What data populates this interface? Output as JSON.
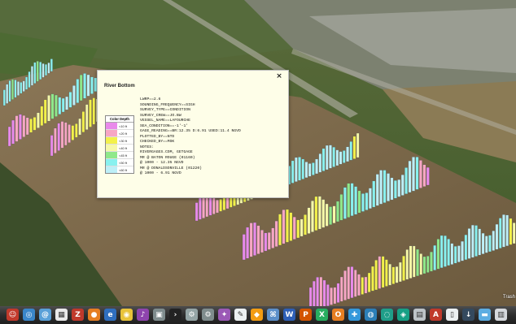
{
  "popup": {
    "title": "River Bottom",
    "close_glyph": "×",
    "legend": {
      "title": "Color Depth",
      "items": [
        {
          "label": "<10 ft",
          "color": "#e98aeb"
        },
        {
          "label": "<20 ft",
          "color": "#f7a6c4"
        },
        {
          "label": "<30 ft",
          "color": "#f3f14a"
        },
        {
          "label": "<40 ft",
          "color": "#f6f8a8"
        },
        {
          "label": "<45 ft",
          "color": "#8fe88a"
        },
        {
          "label": "<50 ft",
          "color": "#89f1ef"
        },
        {
          "label": "<60 ft",
          "color": "#bdeff7"
        }
      ]
    },
    "attributes": [
      "LWRP==2.6",
      "SOUNDING_FREQUENCY==SIGH",
      "SURVEY_TYPE==CONDITION",
      "SURVEY_CREW==JO.BW",
      "VESSEL_NAME==LAFOURCHE",
      "SEA_CONDITION==-1'-1'",
      "GAGE_READING==BR:12.35 D:6.91 USED:11.4 NGVD",
      "PLOTTED_BY==NTD",
      "CHECKED_BY==MSK",
      "NOTES:",
      "RIVERGAGES.COM, GETGAGE",
      "MR @ BATON ROUGE (01160)",
      "@ 1000 - 12.35 NGVD",
      "MR @ DONALDSONVILLE (01220)",
      "@ 1000 - 6.91 NGVD"
    ]
  },
  "dock": {
    "trash_label": "Trash",
    "icons": [
      {
        "name": "finder-icon",
        "color": "#c2392b",
        "glyph": "☺"
      },
      {
        "name": "safari-icon",
        "color": "#3a86c9",
        "glyph": "◎"
      },
      {
        "name": "mail-icon",
        "color": "#5aa0d8",
        "glyph": "@"
      },
      {
        "name": "calendar-icon",
        "color": "#e9e9e9",
        "glyph": "▦"
      },
      {
        "name": "filezilla-icon",
        "color": "#c0392b",
        "glyph": "Z"
      },
      {
        "name": "firefox-icon",
        "color": "#e67e22",
        "glyph": "●"
      },
      {
        "name": "ie-icon",
        "color": "#2f6fbf",
        "glyph": "e"
      },
      {
        "name": "chrome-icon",
        "color": "#e8c33a",
        "glyph": "◉"
      },
      {
        "name": "itunes-icon",
        "color": "#8e44ad",
        "glyph": "♪"
      },
      {
        "name": "photo-icon",
        "color": "#7f8c8d",
        "glyph": "▣"
      },
      {
        "name": "terminal-icon",
        "color": "#222222",
        "glyph": "›"
      },
      {
        "name": "utility-icon",
        "color": "#95a5a6",
        "glyph": "⚙"
      },
      {
        "name": "settings-icon",
        "color": "#7f8c8d",
        "glyph": "⚙"
      },
      {
        "name": "preview-icon",
        "color": "#9b59b6",
        "glyph": "✦"
      },
      {
        "name": "textedit-icon",
        "color": "#ecf0f1",
        "glyph": "✎"
      },
      {
        "name": "app-icon",
        "color": "#f39c12",
        "glyph": "◆"
      },
      {
        "name": "mac-icon",
        "color": "#5c8fc9",
        "glyph": "⌘"
      },
      {
        "name": "word-icon",
        "color": "#2e5fb6",
        "glyph": "W"
      },
      {
        "name": "powerpoint-icon",
        "color": "#d35400",
        "glyph": "P"
      },
      {
        "name": "excel-icon",
        "color": "#27ae60",
        "glyph": "X"
      },
      {
        "name": "outlook-icon",
        "color": "#e67e22",
        "glyph": "O"
      },
      {
        "name": "network-icon",
        "color": "#3498db",
        "glyph": "✚"
      },
      {
        "name": "googleearth-icon",
        "color": "#2c7fb8",
        "glyph": "◍"
      },
      {
        "name": "globe-icon",
        "color": "#1f9e89",
        "glyph": "◌"
      },
      {
        "name": "maps-icon",
        "color": "#16a085",
        "glyph": "◈"
      },
      {
        "name": "photos-icon",
        "color": "#bdc3c7",
        "glyph": "▤"
      },
      {
        "name": "acrobat-icon",
        "color": "#c0392b",
        "glyph": "A"
      },
      {
        "name": "doc-icon",
        "color": "#ecf0f1",
        "glyph": "▯"
      },
      {
        "name": "downloads-icon",
        "color": "#34495e",
        "glyph": "↓"
      },
      {
        "name": "folder-icon",
        "color": "#5dade2",
        "glyph": "▬"
      },
      {
        "name": "trash-icon",
        "color": "#d5d8dc",
        "glyph": "▥"
      }
    ]
  }
}
